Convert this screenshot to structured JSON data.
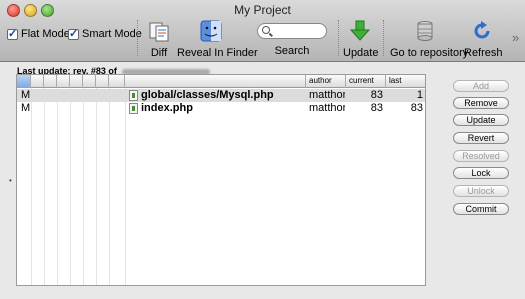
{
  "window": {
    "title": "My Project"
  },
  "toolbar": {
    "flat_mode": {
      "label": "Flat Mode",
      "checked": true
    },
    "smart_mode": {
      "label": "Smart Mode",
      "checked": true
    },
    "items": {
      "diff": "Diff",
      "reveal": "Reveal In Finder",
      "search": "Search",
      "update": "Update",
      "repo": "Go to repository",
      "refresh": "Refresh"
    }
  },
  "status": {
    "last_update": "Last update: rev. #83 of"
  },
  "table": {
    "columns": [
      "author",
      "current",
      "last"
    ],
    "rows": [
      {
        "status": "M",
        "path": "global/classes/Mysql.php",
        "author": "matthor",
        "current": "83",
        "last": "1"
      },
      {
        "status": "M",
        "path": "index.php",
        "author": "matthor",
        "current": "83",
        "last": "83"
      }
    ]
  },
  "actions": {
    "add": "Add",
    "remove": "Remove",
    "update": "Update",
    "revert": "Revert",
    "resolved": "Resolved",
    "lock": "Lock",
    "unlock": "Unlock",
    "commit": "Commit"
  },
  "icons": [
    "diff-icon",
    "finder-icon",
    "search-icon",
    "update-icon",
    "repository-icon",
    "refresh-icon",
    "overflow-chevron-icon"
  ]
}
